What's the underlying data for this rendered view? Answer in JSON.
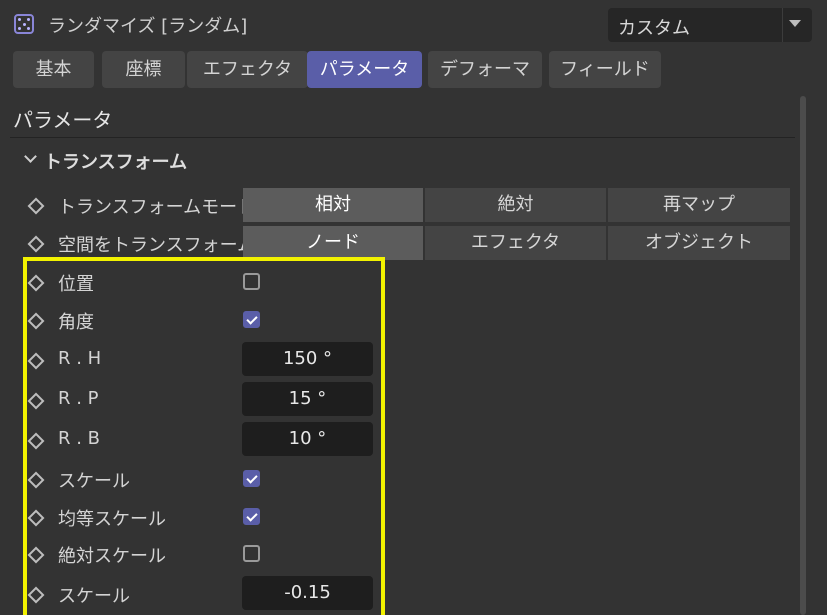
{
  "window": {
    "title": "ランダマイズ [ランダム]",
    "icon": "dice-icon",
    "preset_value": "カスタム"
  },
  "tabs": [
    {
      "label": "基本",
      "active": false
    },
    {
      "label": "座標",
      "active": false
    },
    {
      "label": "エフェクタ",
      "active": false
    },
    {
      "label": "パラメータ",
      "active": true
    },
    {
      "label": "デフォーマ",
      "active": false
    },
    {
      "label": "フィールド",
      "active": false
    }
  ],
  "section": {
    "title": "パラメータ",
    "group_label": "トランスフォーム"
  },
  "rows": {
    "transform_mode": {
      "label": "トランスフォームモード",
      "options": [
        "相対",
        "絶対",
        "再マップ"
      ],
      "selected": "相対"
    },
    "transform_space": {
      "label": "空間をトランスフォーム",
      "options": [
        "ノード",
        "エフェクタ",
        "オブジェクト"
      ],
      "selected": "ノード"
    },
    "position": {
      "label": "位置",
      "checked": false
    },
    "rotation": {
      "label": "角度",
      "checked": true
    },
    "rh": {
      "label": "R . H",
      "value": "150 °"
    },
    "rp": {
      "label": "R . P",
      "value": "15 °"
    },
    "rb": {
      "label": "R . B",
      "value": "10 °"
    },
    "scale": {
      "label": "スケール",
      "checked": true
    },
    "uniform_scale": {
      "label": "均等スケール",
      "checked": true
    },
    "absolute_scale": {
      "label": "絶対スケール",
      "checked": false
    },
    "scale_value": {
      "label": "スケール",
      "value": "-0.15"
    }
  },
  "colors": {
    "accent": "#5a5ea8",
    "highlight": "#f2f200",
    "background": "#333333"
  }
}
